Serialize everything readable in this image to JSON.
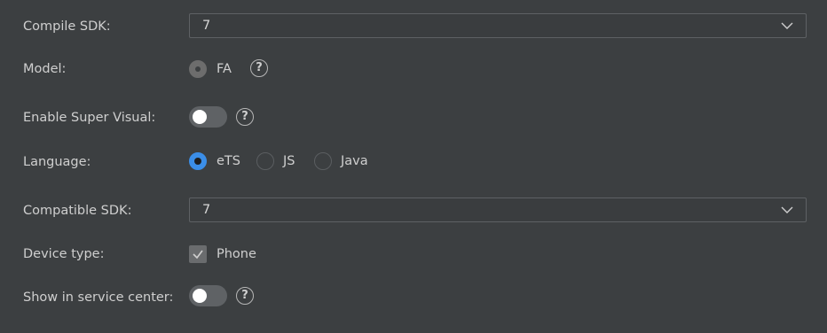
{
  "compile_sdk": {
    "label": "Compile SDK:",
    "value": "7"
  },
  "model": {
    "label": "Model:",
    "option": "FA",
    "help": "?"
  },
  "super_visual": {
    "label": "Enable Super Visual:",
    "enabled": false,
    "help": "?"
  },
  "language": {
    "label": "Language:",
    "options": [
      "eTS",
      "JS",
      "Java"
    ],
    "selected": "eTS"
  },
  "compatible_sdk": {
    "label": "Compatible SDK:",
    "value": "7"
  },
  "device_type": {
    "label": "Device type:",
    "option": "Phone",
    "checked": true
  },
  "service_center": {
    "label": "Show in service center:",
    "enabled": false,
    "help": "?"
  },
  "colors": {
    "background": "#3c3f41",
    "accent": "#3b8ee8",
    "text": "#cfcfcf"
  }
}
